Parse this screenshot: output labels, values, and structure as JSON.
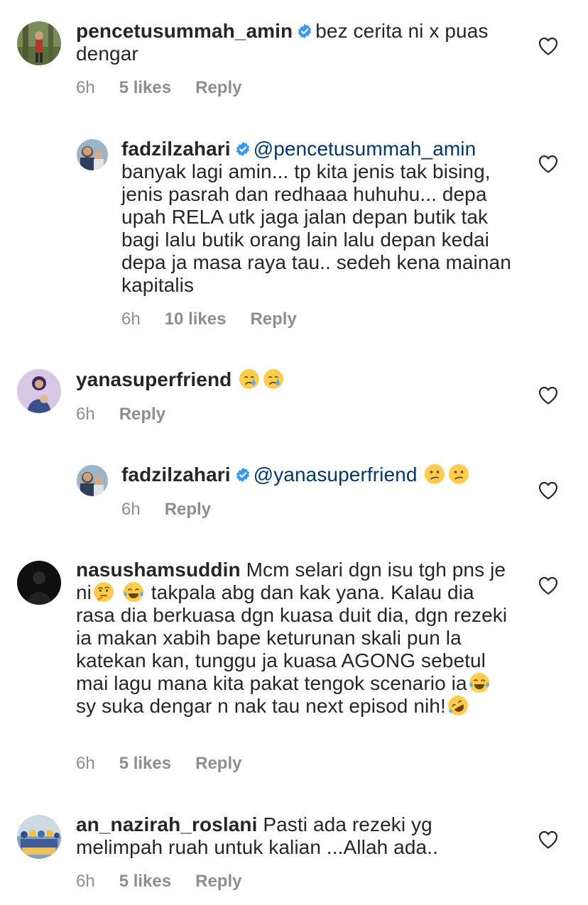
{
  "comments": [
    {
      "username": "pencetusummah_amin",
      "verified": true,
      "text": "bez cerita ni x puas dengar",
      "time": "6h",
      "likes": "5 likes",
      "reply": "Reply"
    },
    {
      "username": "fadzilzahari",
      "verified": true,
      "mention": "@pencetusummah_amin",
      "text": "banyak lagi amin... tp kita jenis tak bising, jenis pasrah dan redhaaa huhuhu... depa upah RELA utk jaga jalan depan butik tak bagi lalu butik orang lain lalu depan kedai depa ja masa raya tau.. sedeh kena mainan kapitalis",
      "time": "6h",
      "likes": "10 likes",
      "reply": "Reply"
    },
    {
      "username": "yanasuperfriend",
      "emojis": [
        "crying-face-emoji",
        "crying-face-emoji"
      ],
      "time": "6h",
      "reply": "Reply"
    },
    {
      "username": "fadzilzahari",
      "verified": true,
      "mention": "@yanasuperfriend",
      "emojis": [
        "confused-face-emoji",
        "confused-face-emoji"
      ],
      "time": "6h",
      "reply": "Reply"
    },
    {
      "username": "nasushamsuddin",
      "text_part1": "Mcm selari dgn isu tgh pns je ni",
      "text_part2": "takpala abg dan kak yana. Kalau dia rasa dia berkuasa dgn kuasa duit dia, dgn rezeki ia makan xabih bape keturunan skali pun la katekan kan, tunggu ja kuasa AGONG sebetul mai lagu mana kita pakat tengok scenario ia",
      "text_part3": "sy suka dengar n nak tau next episod nih!",
      "time": "6h",
      "likes": "5 likes",
      "reply": "Reply"
    },
    {
      "username": "an_nazirah_roslani",
      "text": "Pasti ada rezeki yg melimpah ruah untuk kalian ...Allah ada..",
      "time": "6h",
      "likes": "5 likes",
      "reply": "Reply"
    }
  ],
  "colors": {
    "text": "#262626",
    "secondary": "#8e8e8e",
    "mention": "#00376b",
    "verified": "#3897f0"
  }
}
